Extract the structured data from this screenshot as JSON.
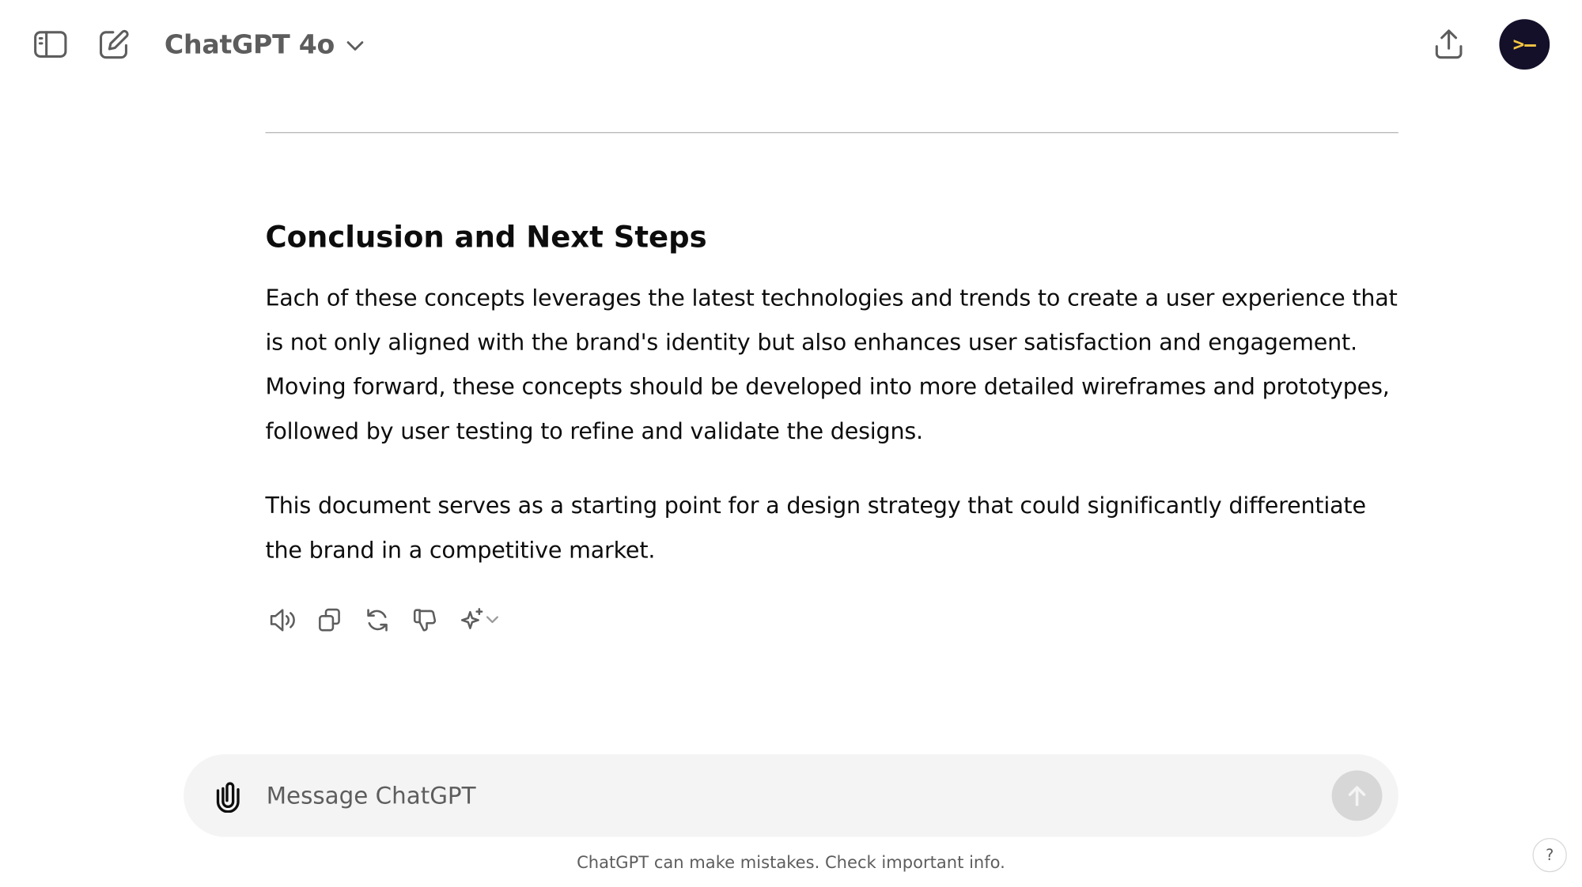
{
  "header": {
    "model_name": "ChatGPT 4o",
    "avatar_text": ">–",
    "icons": {
      "sidebar": "sidebar-toggle-icon",
      "new_chat": "pencil-square-icon",
      "model_dropdown": "chevron-down-icon",
      "share": "share-upload-icon"
    }
  },
  "message": {
    "heading": "Conclusion and Next Steps",
    "paragraphs": [
      "Each of these concepts leverages the latest technologies and trends to create a user experience that is not only aligned with the brand's identity but also enhances user satisfaction and engagement. Moving forward, these concepts should be developed into more detailed wireframes and prototypes, followed by user testing to refine and validate the designs.",
      "This document serves as a starting point for a design strategy that could significantly differentiate the brand in a competitive market."
    ],
    "action_icons": [
      "speaker-icon",
      "copy-icon",
      "regenerate-icon",
      "thumbs-down-icon",
      "sparkle-icon",
      "chevron-down-icon"
    ]
  },
  "composer": {
    "placeholder": "Message ChatGPT",
    "value": "",
    "icons": {
      "attach": "paperclip-icon",
      "send": "arrow-up-icon"
    }
  },
  "footer": {
    "disclaimer": "ChatGPT can make mistakes. Check important info.",
    "help_label": "?"
  },
  "colors": {
    "text": "#0d0d0d",
    "muted": "#5d5d5d",
    "composer_bg": "#f4f4f4",
    "send_disabled": "#d7d7d7",
    "avatar_bg": "#14102a",
    "avatar_fg": "#f5c542"
  }
}
